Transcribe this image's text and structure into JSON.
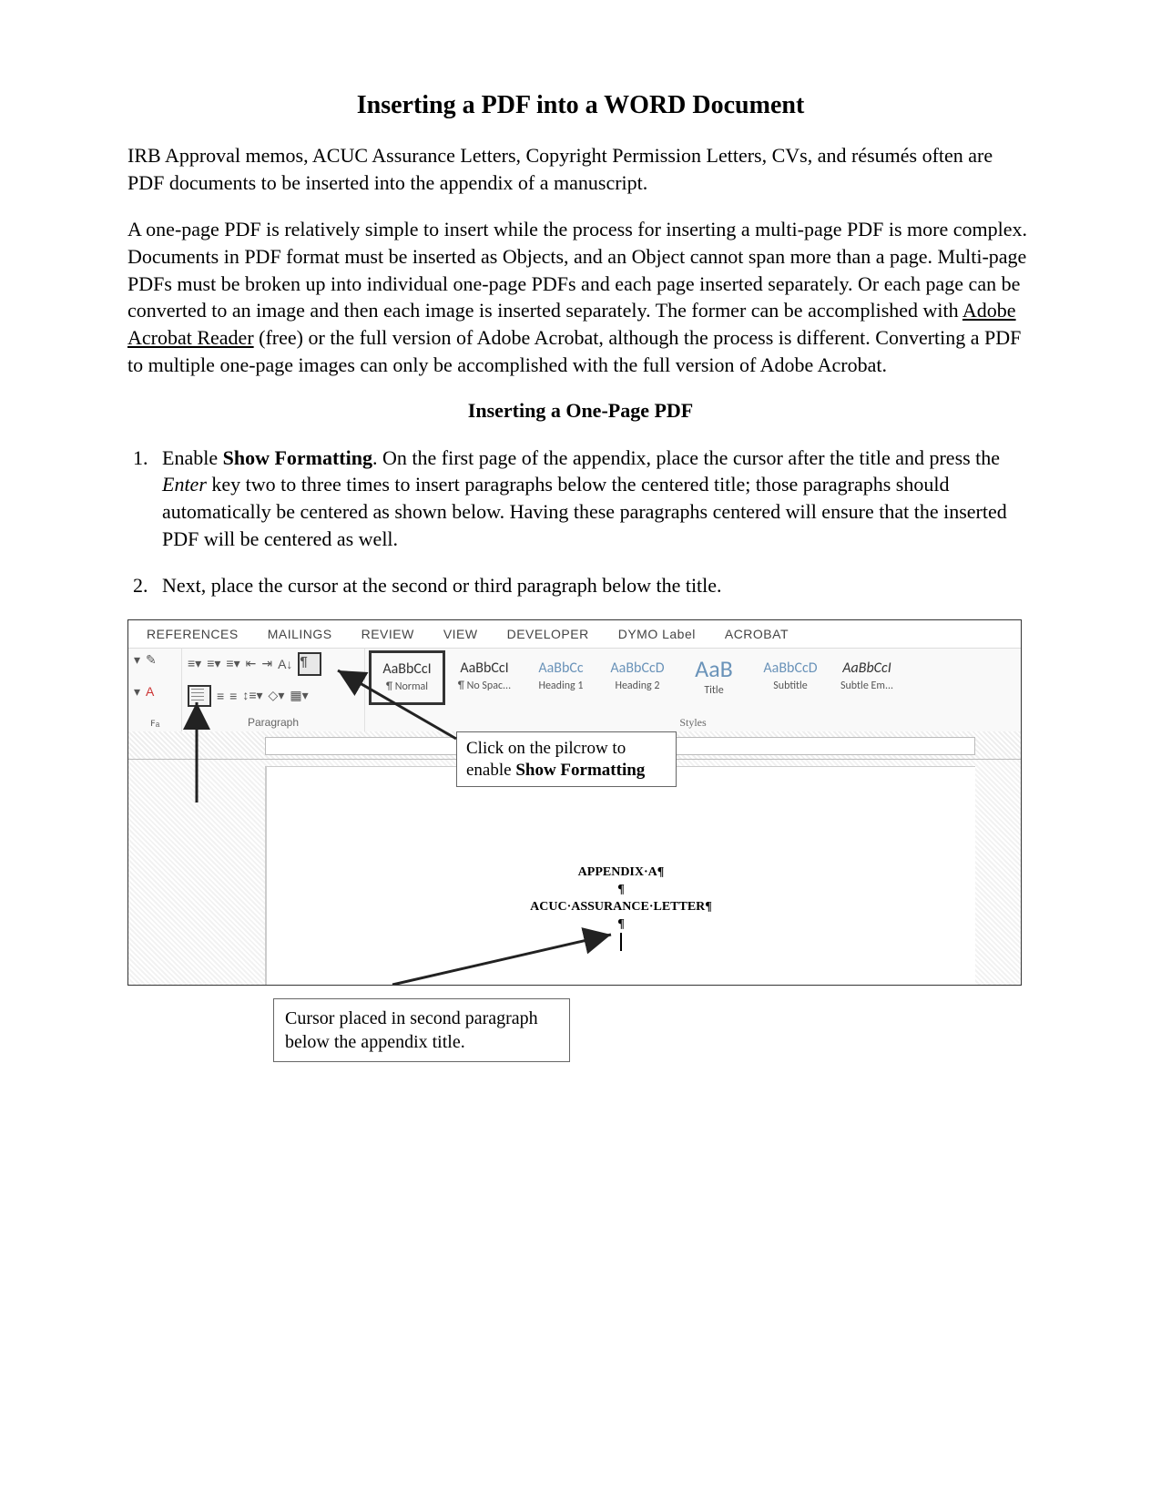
{
  "title": "Inserting a PDF into a WORD Document",
  "intro1": "IRB Approval memos, ACUC Assurance Letters, Copyright Permission Letters, CVs, and résumés often are PDF documents to be inserted into the appendix of a manuscript.",
  "intro2a": "A one-page PDF is relatively simple to insert while the process for inserting a multi-page PDF is more complex. Documents in PDF format must be inserted as Objects, and an Object cannot span more than a page. Multi-page PDFs must be broken up into individual one-page PDFs and each page inserted separately. Or each page can be converted to an image and then each image is inserted separately. The former can be accomplished with ",
  "intro2link": "Adobe Acrobat Reader",
  "intro2b": " (free) or the full version of Adobe Acrobat, although the process is different. Converting a PDF to multiple one-page images can only be accomplished with the full version of Adobe Acrobat.",
  "subhead": "Inserting a One-Page PDF",
  "step1_a": "Enable ",
  "step1_b": "Show Formatting",
  "step1_c": ". On the first page of the appendix, place the cursor after the title and press the ",
  "step1_d": "Enter",
  "step1_e": " key two to three times to insert paragraphs below the centered title; those paragraphs should automatically be centered as shown below. Having these paragraphs centered will ensure that the inserted PDF will be centered as well.",
  "step2": "Next, place the cursor at the second or third paragraph below the title.",
  "ribbon": {
    "tabs": [
      "REFERENCES",
      "MAILINGS",
      "REVIEW",
      "VIEW",
      "DEVELOPER",
      "DYMO Label",
      "ACROBAT"
    ],
    "paragraph_label": "Paragraph",
    "pilcrow": "¶",
    "styles_label": "Styles",
    "styles": [
      {
        "sample": "AaBbCcI",
        "name": "¶ Normal",
        "cls": "selected"
      },
      {
        "sample": "AaBbCcI",
        "name": "¶ No Spac...",
        "cls": ""
      },
      {
        "sample": "AaBbCc",
        "name": "Heading 1",
        "cls": "blue"
      },
      {
        "sample": "AaBbCcD",
        "name": "Heading 2",
        "cls": "blue"
      },
      {
        "sample": "AaB",
        "name": "Title",
        "cls": "lg"
      },
      {
        "sample": "AaBbCcD",
        "name": "Subtitle",
        "cls": "blue"
      },
      {
        "sample": "AaBbCcI",
        "name": "Subtle Em...",
        "cls": "it"
      }
    ]
  },
  "callout1a": "Click on the pilcrow to enable ",
  "callout1b": "Show Formatting",
  "doc": {
    "line1": "APPENDIX·A¶",
    "pil": "¶",
    "line2": "ACUC·ASSURANCE·LETTER¶"
  },
  "callout2": "Cursor placed in second paragraph below the appendix title."
}
